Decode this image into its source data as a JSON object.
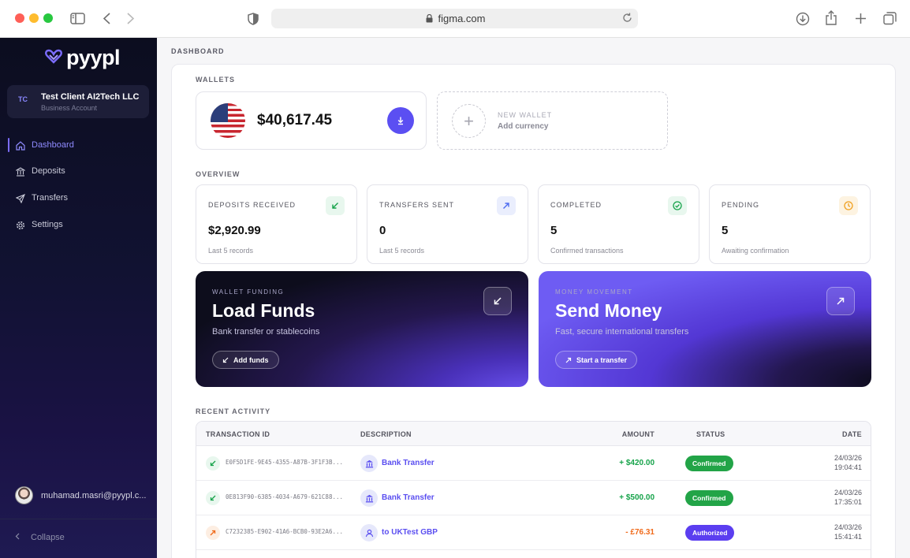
{
  "browser": {
    "url": "figma.com"
  },
  "sidebar": {
    "brand": "pyypl",
    "account": {
      "initials": "TC",
      "name": "Test Client AI2Tech LLC",
      "type": "Business Account"
    },
    "nav": [
      {
        "label": "Dashboard",
        "icon": "home-icon",
        "active": true
      },
      {
        "label": "Deposits",
        "icon": "bank-icon",
        "active": false
      },
      {
        "label": "Transfers",
        "icon": "send-icon",
        "active": false
      },
      {
        "label": "Settings",
        "icon": "gear-icon",
        "active": false
      }
    ],
    "user_email": "muhamad.masri@pyypl.c...",
    "collapse_label": "Collapse"
  },
  "main": {
    "breadcrumb": "DASHBOARD",
    "wallets_title": "WALLETS",
    "wallet": {
      "currency_flag": "us-flag-icon",
      "balance": "$40,617.45"
    },
    "new_wallet": {
      "label": "NEW WALLET",
      "sub": "Add currency"
    },
    "overview_title": "OVERVIEW",
    "stats": [
      {
        "label": "DEPOSITS RECEIVED",
        "value": "$2,920.99",
        "sub": "Last 5 records",
        "icon": "arrow-down-left-icon",
        "color": "#16a34a",
        "bg": "#e8f7ee"
      },
      {
        "label": "TRANSFERS SENT",
        "value": "0",
        "sub": "Last 5 records",
        "icon": "arrow-up-right-icon",
        "color": "#4f6df0",
        "bg": "#eaeefd"
      },
      {
        "label": "COMPLETED",
        "value": "5",
        "sub": "Confirmed transactions",
        "icon": "check-circle-icon",
        "color": "#16a34a",
        "bg": "#e8f7ee"
      },
      {
        "label": "PENDING",
        "value": "5",
        "sub": "Awaiting confirmation",
        "icon": "clock-icon",
        "color": "#f0a020",
        "bg": "#fdf3e1"
      }
    ],
    "load_funds": {
      "eyebrow": "WALLET FUNDING",
      "title": "Load Funds",
      "subtitle": "Bank transfer or stablecoins",
      "button": "Add funds"
    },
    "send_money": {
      "eyebrow": "MONEY MOVEMENT",
      "title": "Send Money",
      "subtitle": "Fast, secure international transfers",
      "button": "Start a transfer"
    },
    "recent_title": "RECENT ACTIVITY",
    "table": {
      "headers": [
        "TRANSACTION ID",
        "DESCRIPTION",
        "AMOUNT",
        "STATUS",
        "DATE"
      ],
      "rows": [
        {
          "direction": "in",
          "id": "E0F5D1FE-9E45-4355-A87B-3F1F3B...",
          "desc_icon": "bank-icon",
          "description": "Bank Transfer",
          "amount": "+ $420.00",
          "amount_color": "#16a34a",
          "status": "Confirmed",
          "status_color": "#22a447",
          "date": "24/03/26",
          "time": "19:04:41"
        },
        {
          "direction": "in",
          "id": "0E813F90-6385-4034-A679-621C88...",
          "desc_icon": "bank-icon",
          "description": "Bank Transfer",
          "amount": "+ $500.00",
          "amount_color": "#16a34a",
          "status": "Confirmed",
          "status_color": "#22a447",
          "date": "24/03/26",
          "time": "17:35:01"
        },
        {
          "direction": "out",
          "id": "C7232385-E902-41A6-BCB0-93E2A6...",
          "desc_icon": "user-icon",
          "description": "to UKTest GBP",
          "amount": "- £76.31",
          "amount_color": "#f06a1a",
          "status": "Authorized",
          "status_color": "#5b3ef0",
          "date": "24/03/26",
          "time": "15:41:41"
        }
      ]
    }
  }
}
